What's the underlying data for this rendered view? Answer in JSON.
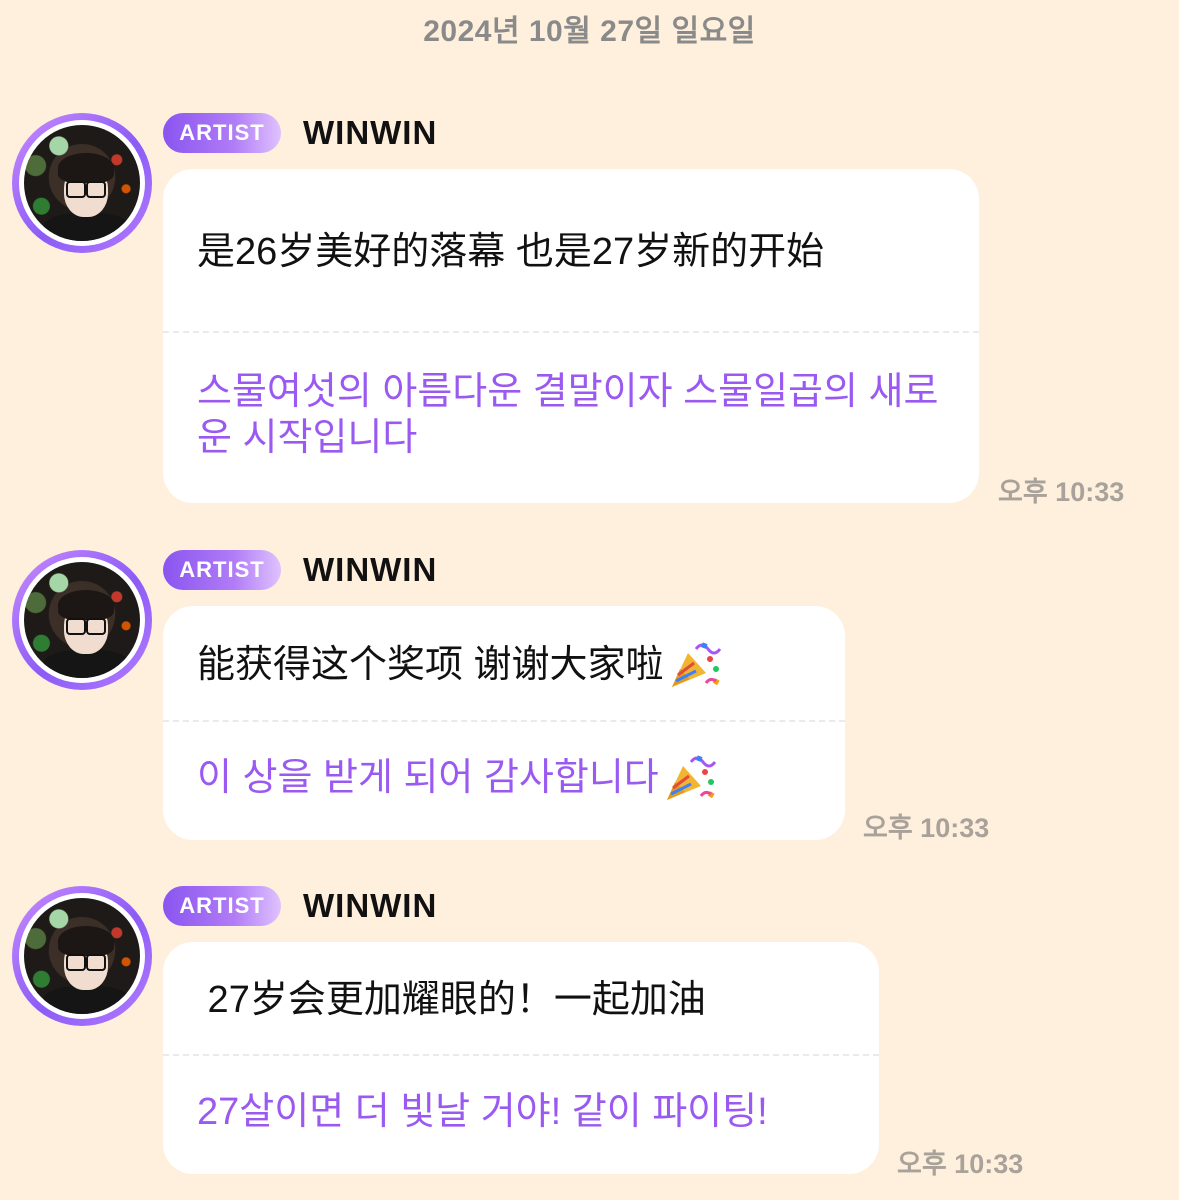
{
  "date_header": "2024년 10월 27일 일요일",
  "colors": {
    "background": "#FEF0DC",
    "bubble": "#FFFFFF",
    "translation_text": "#9A5AF2",
    "badge_gradient_start": "#8A55F0",
    "timestamp": "#A8A29A"
  },
  "messages": [
    {
      "badge": "ARTIST",
      "sender": "WINWIN",
      "original": "是26岁美好的落幕 也是27岁新的开始",
      "translation": "스물여섯의 아름다운 결말이자 스물일곱의 새로운 시작입니다",
      "time": "오후 10:33"
    },
    {
      "badge": "ARTIST",
      "sender": "WINWIN",
      "original": "能获得这个奖项 谢谢大家啦",
      "original_icon": "party-popper-icon",
      "translation": "이 상을 받게 되어 감사합니다",
      "translation_icon": "party-popper-icon",
      "time": "오후 10:33"
    },
    {
      "badge": "ARTIST",
      "sender": "WINWIN",
      "original": " 27岁会更加耀眼的！一起加油",
      "translation": "27살이면 더 빛날 거야! 같이 파이팅!",
      "time": "오후 10:33"
    }
  ]
}
